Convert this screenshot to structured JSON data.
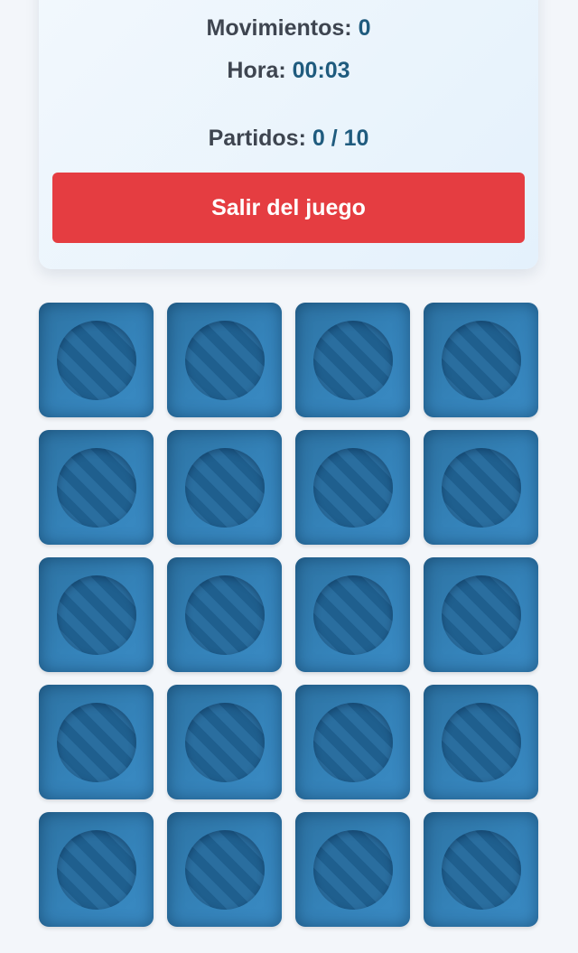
{
  "stats": {
    "moves_label": "Movimientos:",
    "moves_value": "0",
    "time_label": "Hora:",
    "time_value": "00:03",
    "matches_label": "Partidos:",
    "matches_value": "0 / 10"
  },
  "exit_button": {
    "label": "Salir del juego"
  },
  "board": {
    "columns": 4,
    "rows": 5,
    "card_count": 20,
    "face_down_icon": "striped-circle-icon"
  },
  "colors": {
    "accent_red": "#e53d41",
    "card_blue": "#3584bb",
    "value_blue": "#1f5b7e"
  }
}
